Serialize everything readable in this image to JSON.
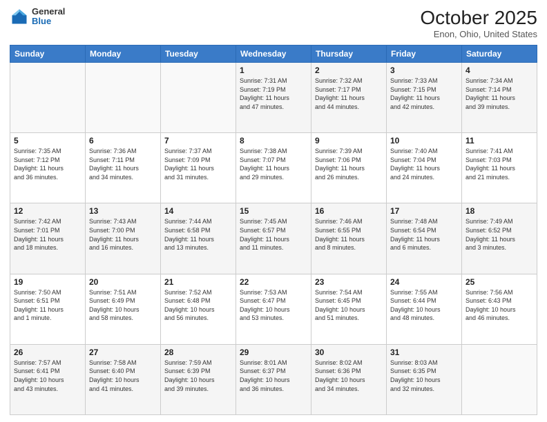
{
  "header": {
    "logo": {
      "general": "General",
      "blue": "Blue"
    },
    "title": "October 2025",
    "location": "Enon, Ohio, United States"
  },
  "weekdays": [
    "Sunday",
    "Monday",
    "Tuesday",
    "Wednesday",
    "Thursday",
    "Friday",
    "Saturday"
  ],
  "weeks": [
    [
      {
        "day": "",
        "info": ""
      },
      {
        "day": "",
        "info": ""
      },
      {
        "day": "",
        "info": ""
      },
      {
        "day": "1",
        "info": "Sunrise: 7:31 AM\nSunset: 7:19 PM\nDaylight: 11 hours\nand 47 minutes."
      },
      {
        "day": "2",
        "info": "Sunrise: 7:32 AM\nSunset: 7:17 PM\nDaylight: 11 hours\nand 44 minutes."
      },
      {
        "day": "3",
        "info": "Sunrise: 7:33 AM\nSunset: 7:15 PM\nDaylight: 11 hours\nand 42 minutes."
      },
      {
        "day": "4",
        "info": "Sunrise: 7:34 AM\nSunset: 7:14 PM\nDaylight: 11 hours\nand 39 minutes."
      }
    ],
    [
      {
        "day": "5",
        "info": "Sunrise: 7:35 AM\nSunset: 7:12 PM\nDaylight: 11 hours\nand 36 minutes."
      },
      {
        "day": "6",
        "info": "Sunrise: 7:36 AM\nSunset: 7:11 PM\nDaylight: 11 hours\nand 34 minutes."
      },
      {
        "day": "7",
        "info": "Sunrise: 7:37 AM\nSunset: 7:09 PM\nDaylight: 11 hours\nand 31 minutes."
      },
      {
        "day": "8",
        "info": "Sunrise: 7:38 AM\nSunset: 7:07 PM\nDaylight: 11 hours\nand 29 minutes."
      },
      {
        "day": "9",
        "info": "Sunrise: 7:39 AM\nSunset: 7:06 PM\nDaylight: 11 hours\nand 26 minutes."
      },
      {
        "day": "10",
        "info": "Sunrise: 7:40 AM\nSunset: 7:04 PM\nDaylight: 11 hours\nand 24 minutes."
      },
      {
        "day": "11",
        "info": "Sunrise: 7:41 AM\nSunset: 7:03 PM\nDaylight: 11 hours\nand 21 minutes."
      }
    ],
    [
      {
        "day": "12",
        "info": "Sunrise: 7:42 AM\nSunset: 7:01 PM\nDaylight: 11 hours\nand 18 minutes."
      },
      {
        "day": "13",
        "info": "Sunrise: 7:43 AM\nSunset: 7:00 PM\nDaylight: 11 hours\nand 16 minutes."
      },
      {
        "day": "14",
        "info": "Sunrise: 7:44 AM\nSunset: 6:58 PM\nDaylight: 11 hours\nand 13 minutes."
      },
      {
        "day": "15",
        "info": "Sunrise: 7:45 AM\nSunset: 6:57 PM\nDaylight: 11 hours\nand 11 minutes."
      },
      {
        "day": "16",
        "info": "Sunrise: 7:46 AM\nSunset: 6:55 PM\nDaylight: 11 hours\nand 8 minutes."
      },
      {
        "day": "17",
        "info": "Sunrise: 7:48 AM\nSunset: 6:54 PM\nDaylight: 11 hours\nand 6 minutes."
      },
      {
        "day": "18",
        "info": "Sunrise: 7:49 AM\nSunset: 6:52 PM\nDaylight: 11 hours\nand 3 minutes."
      }
    ],
    [
      {
        "day": "19",
        "info": "Sunrise: 7:50 AM\nSunset: 6:51 PM\nDaylight: 11 hours\nand 1 minute."
      },
      {
        "day": "20",
        "info": "Sunrise: 7:51 AM\nSunset: 6:49 PM\nDaylight: 10 hours\nand 58 minutes."
      },
      {
        "day": "21",
        "info": "Sunrise: 7:52 AM\nSunset: 6:48 PM\nDaylight: 10 hours\nand 56 minutes."
      },
      {
        "day": "22",
        "info": "Sunrise: 7:53 AM\nSunset: 6:47 PM\nDaylight: 10 hours\nand 53 minutes."
      },
      {
        "day": "23",
        "info": "Sunrise: 7:54 AM\nSunset: 6:45 PM\nDaylight: 10 hours\nand 51 minutes."
      },
      {
        "day": "24",
        "info": "Sunrise: 7:55 AM\nSunset: 6:44 PM\nDaylight: 10 hours\nand 48 minutes."
      },
      {
        "day": "25",
        "info": "Sunrise: 7:56 AM\nSunset: 6:43 PM\nDaylight: 10 hours\nand 46 minutes."
      }
    ],
    [
      {
        "day": "26",
        "info": "Sunrise: 7:57 AM\nSunset: 6:41 PM\nDaylight: 10 hours\nand 43 minutes."
      },
      {
        "day": "27",
        "info": "Sunrise: 7:58 AM\nSunset: 6:40 PM\nDaylight: 10 hours\nand 41 minutes."
      },
      {
        "day": "28",
        "info": "Sunrise: 7:59 AM\nSunset: 6:39 PM\nDaylight: 10 hours\nand 39 minutes."
      },
      {
        "day": "29",
        "info": "Sunrise: 8:01 AM\nSunset: 6:37 PM\nDaylight: 10 hours\nand 36 minutes."
      },
      {
        "day": "30",
        "info": "Sunrise: 8:02 AM\nSunset: 6:36 PM\nDaylight: 10 hours\nand 34 minutes."
      },
      {
        "day": "31",
        "info": "Sunrise: 8:03 AM\nSunset: 6:35 PM\nDaylight: 10 hours\nand 32 minutes."
      },
      {
        "day": "",
        "info": ""
      }
    ]
  ]
}
